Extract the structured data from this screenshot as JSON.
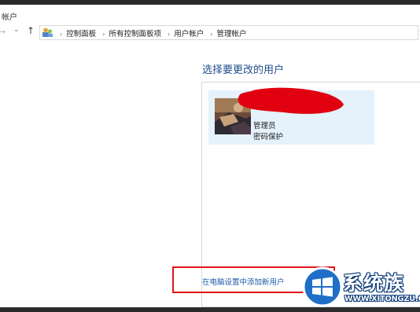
{
  "window": {
    "title": "帐户"
  },
  "nav": {
    "back_icon": "back-arrow-icon",
    "forward_icon": "chevron-down-icon",
    "up_icon": "up-arrow-icon"
  },
  "breadcrumb": {
    "icon": "control-panel-icon",
    "items": [
      "控制面板",
      "所有控制面板项",
      "用户帐户",
      "管理帐户"
    ],
    "separator": "›"
  },
  "main": {
    "title": "选择要更改的用户",
    "users": [
      {
        "name_redacted": true,
        "role": "管理员",
        "password_status": "密码保护",
        "avatar_icon": "user-avatar"
      }
    ],
    "add_user_link": "在电脑设置中添加新用户"
  },
  "watermark": {
    "title": "系统族",
    "url": "WWW.XITONGZU.COM",
    "logo_icon": "windows-logo-icon"
  },
  "colors": {
    "link": "#1e5aa8",
    "title": "#1e4d8c",
    "tile_bg": "#e5f1fb",
    "highlight": "#e0141e",
    "redaction": "#e00010"
  }
}
